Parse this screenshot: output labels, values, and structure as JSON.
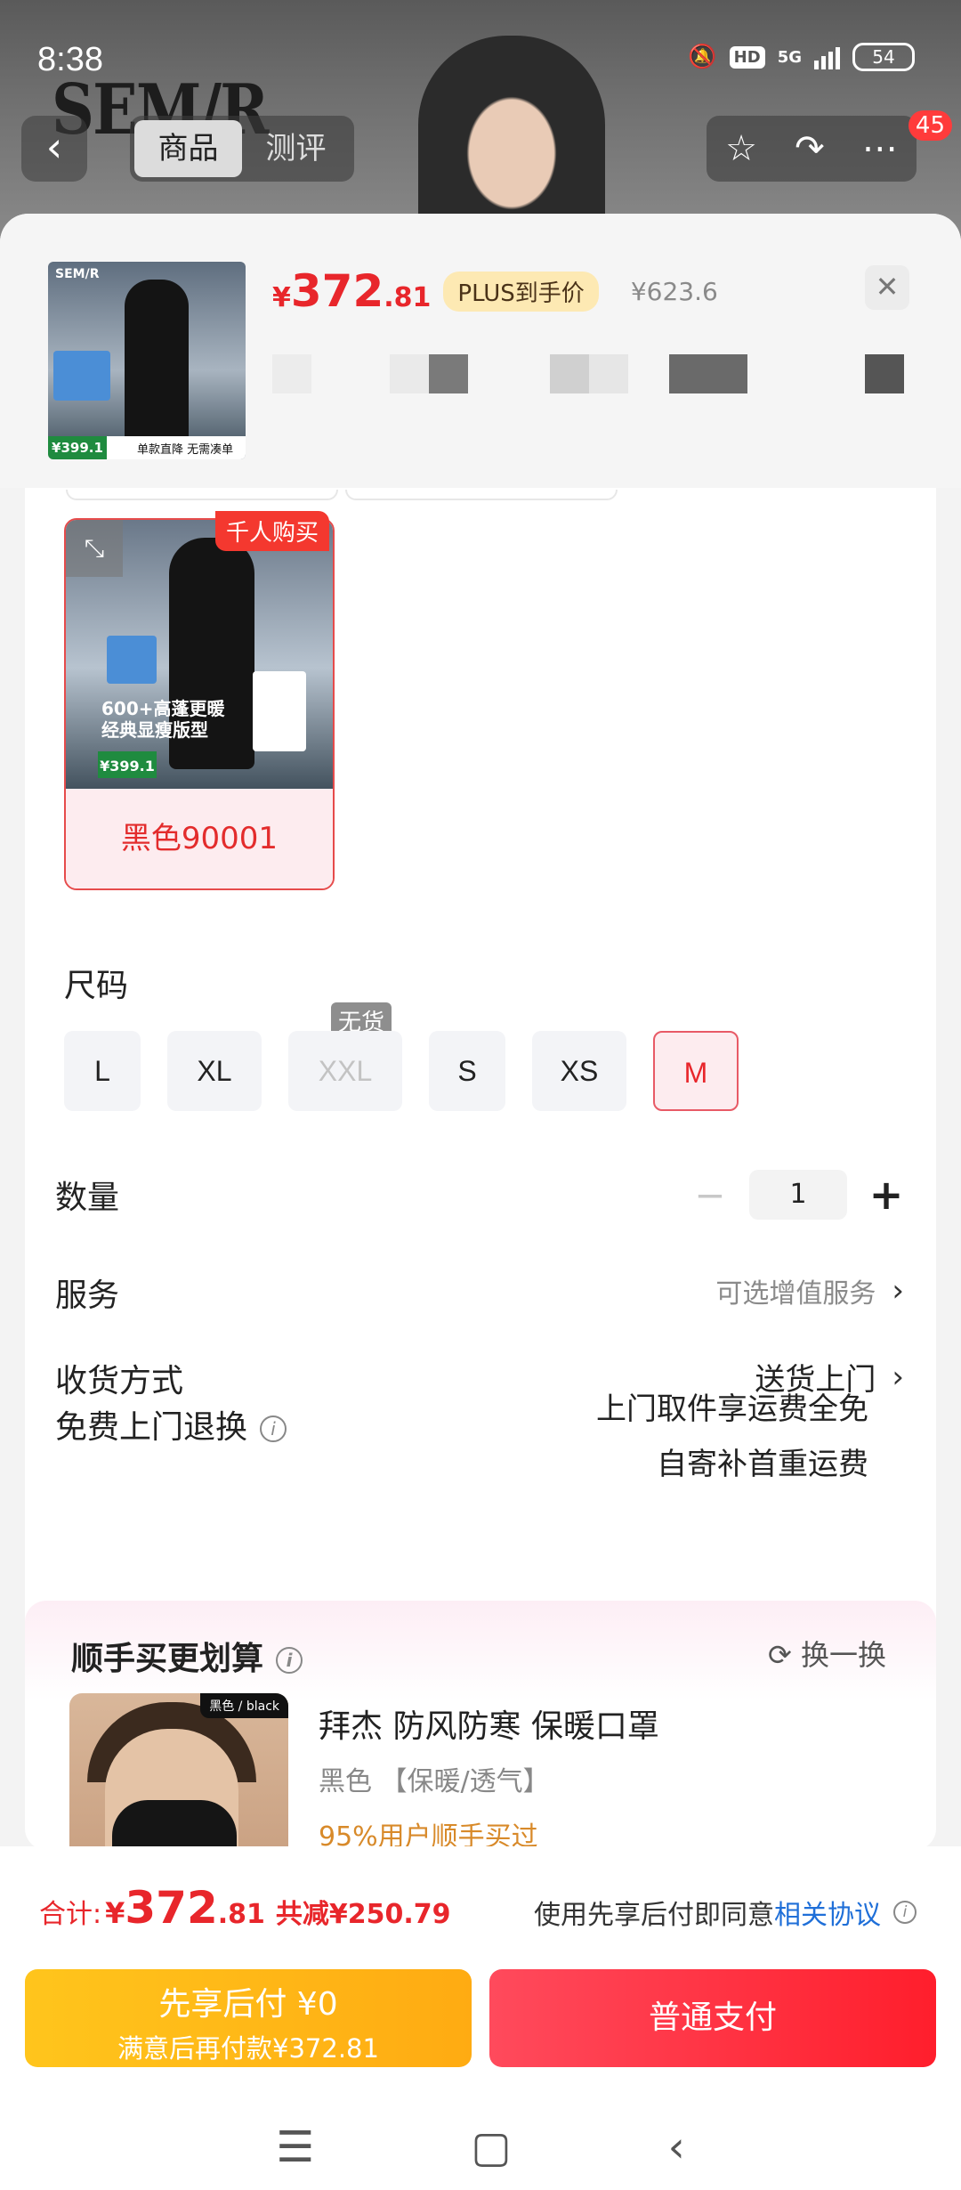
{
  "status_bar": {
    "time": "8:38",
    "hd": "HD",
    "network": "5G",
    "battery": "54"
  },
  "background": {
    "brand_text": "SEM/R"
  },
  "nav": {
    "back_icon": "chevron-left-icon",
    "tabs": [
      {
        "label": "商品",
        "selected": true
      },
      {
        "label": "测评",
        "selected": false
      }
    ],
    "favorite_icon": "star-icon",
    "share_icon": "share-icon",
    "more_icon": "more-icon",
    "badge": "45"
  },
  "product": {
    "thumb_brand": "SEM/R",
    "thumb_price": "¥399.1",
    "thumb_footer": "单款直降 无需凑单",
    "price_symbol": "¥",
    "price_int": "372",
    "price_dec": ".81",
    "plus_tag": "PLUS到手价",
    "original_price": "¥623.6"
  },
  "color_option": {
    "badge": "千人购买",
    "label": "黑色90001",
    "image_text_1": "600+高蓬更暖",
    "image_text_2": "经典显瘦版型",
    "image_price": "¥399.1"
  },
  "size": {
    "title": "尺码",
    "options": [
      "L",
      "XL",
      "XXL",
      "S",
      "XS",
      "M"
    ],
    "unavailable": "XXL",
    "selected": "M",
    "no_stock_label": "无货"
  },
  "quantity": {
    "label": "数量",
    "value": "1",
    "minus": "−",
    "plus": "+"
  },
  "service": {
    "label": "服务",
    "hint": "可选增值服务"
  },
  "delivery": {
    "label": "收货方式",
    "value": "送货上门"
  },
  "return": {
    "label": "免费上门退换",
    "line1": "上门取件享运费全免",
    "line2": "自寄补首重运费"
  },
  "bundle": {
    "title": "顺手买更划算",
    "refresh": "换一换",
    "image_tag": "黑色 / black",
    "name": "拜杰 防风防寒 保暖口罩",
    "spec": "黑色 【保暖/透气】",
    "social": "95%用户顺手买过"
  },
  "footer": {
    "total_label": "合计:",
    "total_symbol": "¥",
    "total_int": "372",
    "total_dec": ".81",
    "saved": "共减¥250.79",
    "agree_text": "使用先享后付即同意",
    "agree_link": "相关协议",
    "btn_later_line1": "先享后付 ¥0",
    "btn_later_line2": "满意后再付款¥372.81",
    "btn_pay": "普通支付"
  },
  "colors": {
    "accent_red": "#e8262b",
    "pay_red": "#ff1e2c",
    "later_yellow": "#ffb516",
    "link_blue": "#1f6fd8"
  }
}
